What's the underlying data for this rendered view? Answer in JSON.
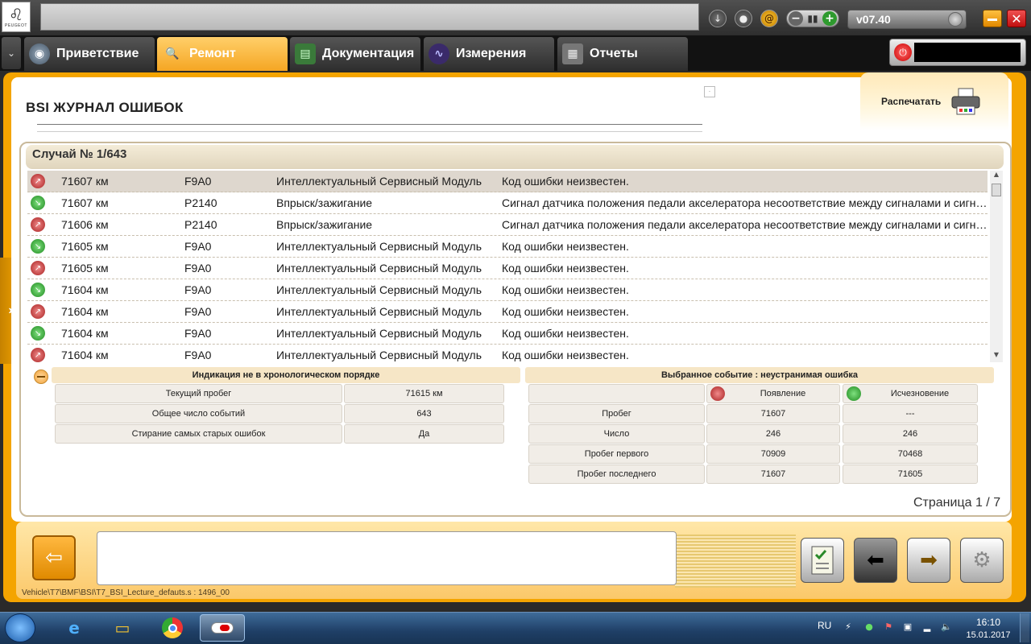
{
  "header": {
    "logo_text": "PEUGEOT",
    "version": "v07.40"
  },
  "tabs": [
    {
      "label": "Приветствие"
    },
    {
      "label": "Ремонт"
    },
    {
      "label": "Документация"
    },
    {
      "label": "Измерения"
    },
    {
      "label": "Отчеты"
    }
  ],
  "page": {
    "title": "BSI  ЖУРНАЛ ОШИБОК",
    "print_label": "Распечатать",
    "case_label": "Случай № 1/643",
    "page_info": "Страница 1 / 7"
  },
  "faults": [
    {
      "type": "appear",
      "km": "71607 км",
      "code": "F9A0",
      "system": "Интеллектуальный Сервисный Модуль",
      "desc": "Код ошибки неизвестен.",
      "selected": true
    },
    {
      "type": "disappear",
      "km": "71607 км",
      "code": "P2140",
      "system": "Впрыск/зажигание",
      "desc": "Сигнал датчика положения педали акселератора несоответствие между сигналами и сигналом"
    },
    {
      "type": "appear",
      "km": "71606 км",
      "code": "P2140",
      "system": "Впрыск/зажигание",
      "desc": "Сигнал датчика положения педали акселератора несоответствие между сигналами и сигналом"
    },
    {
      "type": "disappear",
      "km": "71605 км",
      "code": "F9A0",
      "system": "Интеллектуальный Сервисный Модуль",
      "desc": "Код ошибки неизвестен."
    },
    {
      "type": "appear",
      "km": "71605 км",
      "code": "F9A0",
      "system": "Интеллектуальный Сервисный Модуль",
      "desc": "Код ошибки неизвестен."
    },
    {
      "type": "disappear",
      "km": "71604 км",
      "code": "F9A0",
      "system": "Интеллектуальный Сервисный Модуль",
      "desc": "Код ошибки неизвестен."
    },
    {
      "type": "appear",
      "km": "71604 км",
      "code": "F9A0",
      "system": "Интеллектуальный Сервисный Модуль",
      "desc": "Код ошибки неизвестен."
    },
    {
      "type": "disappear",
      "km": "71604 км",
      "code": "F9A0",
      "system": "Интеллектуальный Сервисный Модуль",
      "desc": "Код ошибки неизвестен."
    },
    {
      "type": "appear",
      "km": "71604 км",
      "code": "F9A0",
      "system": "Интеллектуальный Сервисный Модуль",
      "desc": "Код ошибки неизвестен."
    }
  ],
  "info_left": {
    "header": "Индикация не в хронологическом порядке",
    "rows": [
      {
        "label": "Текущий пробег",
        "value": "71615 км"
      },
      {
        "label": "Общее число событий",
        "value": "643"
      },
      {
        "label": "Стирание самых старых ошибок",
        "value": "Да"
      }
    ]
  },
  "info_right": {
    "header": "Выбранное событие : неустранимая ошибка",
    "col_appear": "Появление",
    "col_disappear": "Исчезновение",
    "rows": [
      {
        "label": "Пробег",
        "appear": "71607",
        "disappear": "---"
      },
      {
        "label": "Число",
        "appear": "246",
        "disappear": "246"
      },
      {
        "label": "Пробег первого",
        "appear": "70909",
        "disappear": "70468"
      },
      {
        "label": "Пробег последнего",
        "appear": "71607",
        "disappear": "71605"
      }
    ]
  },
  "footer": {
    "path": "Vehicle\\T7\\BMF\\BSI\\T7_BSI_Lecture_defauts.s : 1496_00"
  },
  "taskbar": {
    "lang": "RU",
    "time": "16:10",
    "date": "15.01.2017"
  },
  "colors": {
    "accent": "#f4a400",
    "appear": "#c0392b",
    "disappear": "#2e9a2e"
  }
}
